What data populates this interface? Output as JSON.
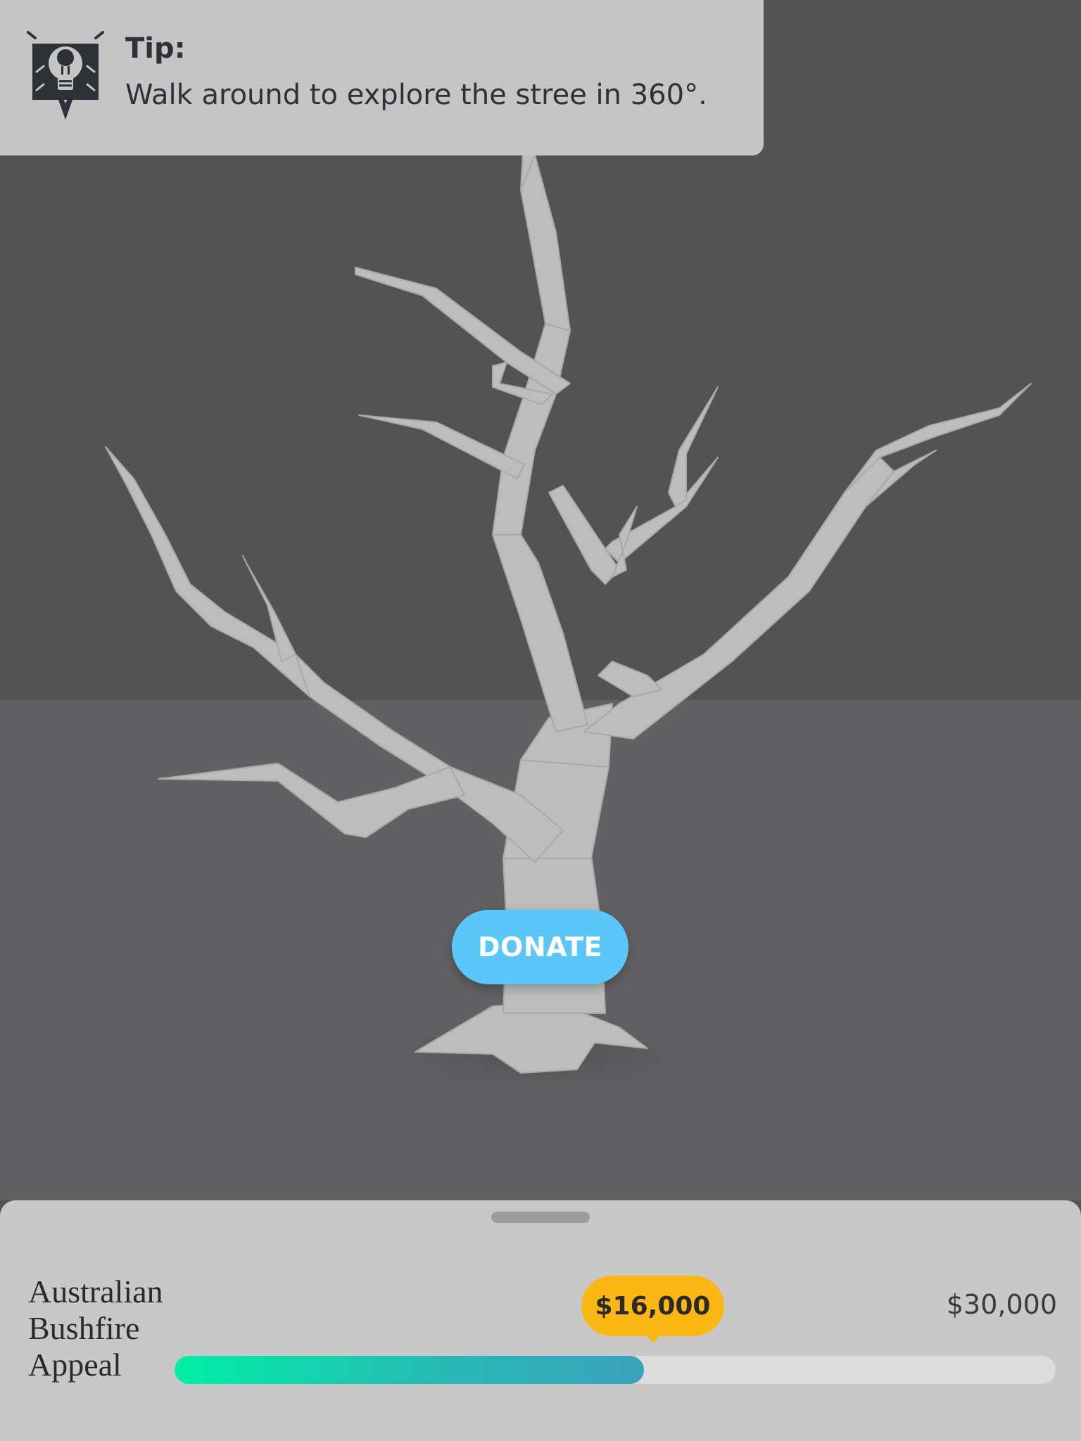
{
  "tip": {
    "title": "Tip:",
    "text": "Walk around to explore the stree in 360°.",
    "icon": "lightbulb-icon"
  },
  "actions": {
    "donate_label": "DONATE"
  },
  "appeal": {
    "name": "Australian Bushfire Appeal",
    "raised_label": "$16,000",
    "goal_label": "$30,000",
    "progress_fraction": 0.533
  },
  "colors": {
    "donate": "#5ac7f8",
    "raised_badge": "#fbb714",
    "progress_start": "#00efa6",
    "progress_end": "#3aa2bd"
  }
}
